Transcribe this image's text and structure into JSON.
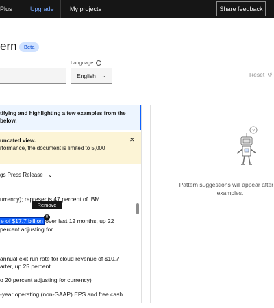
{
  "topbar": {
    "plan_label": "Plus",
    "upgrade_label": "Upgrade",
    "projects_label": "My projects",
    "share_feedback_label": "Share feedback"
  },
  "page": {
    "title": "ern",
    "badge": "Beta"
  },
  "language": {
    "label": "Language",
    "value": "English"
  },
  "reset_label": "Reset",
  "info_banner": {
    "line1": "tifying and highlighting a few examples from the",
    "line2": "below."
  },
  "warning": {
    "title": "uncated view.",
    "message": "rformance, the document is limited to 5,000"
  },
  "document_select": {
    "value": "gs Press Release"
  },
  "document_lines": [
    "urrency); represents 47 percent of IBM",
    "over last 12 months, up 22",
    "percent adjusting for",
    "annual exit run rate for cloud revenue of $10.7",
    "arter, up 25 percent",
    "o 20 percent adjusting for currency)",
    "-year operating (non-GAAP) EPS and free cash"
  ],
  "highlight": {
    "text": "e of $17.7 billion",
    "tooltip": "Remove"
  },
  "suggestions_panel": {
    "line1": "Pattern suggestions will appear after yo",
    "line2": "examples."
  },
  "icons": {
    "info": "info-icon",
    "chevron": "chevron-down-icon",
    "close": "close-icon",
    "reset": "reset-icon",
    "robot": "robot-illustration"
  },
  "colors": {
    "topbar_bg": "#161616",
    "accent_blue": "#0f62fe",
    "warning_bg": "#fcf4d6",
    "info_bg": "#edf5ff"
  }
}
